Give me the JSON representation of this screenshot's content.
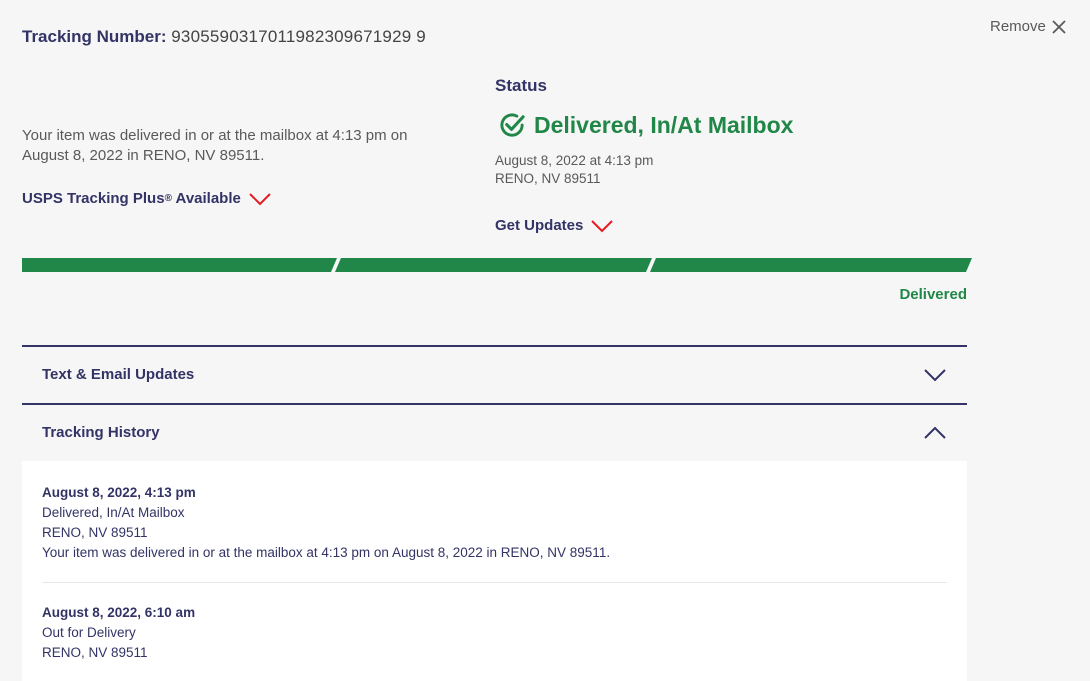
{
  "header": {
    "tracking_label": "Tracking Number:",
    "tracking_number": "9305590317011982309671929 9",
    "remove_label": "Remove"
  },
  "summary": {
    "text": "Your item was delivered in or at the mailbox at 4:13 pm on August 8, 2022 in RENO, NV 89511.",
    "tracking_plus_label": "USPS Tracking Plus",
    "tracking_plus_sup": "®",
    "tracking_plus_suffix": " Available"
  },
  "status": {
    "heading": "Status",
    "title": "Delivered, In/At Mailbox",
    "date": "August 8, 2022 at 4:13 pm",
    "location": "RENO, NV 89511",
    "get_updates_label": "Get Updates",
    "color": "#218748"
  },
  "progress": {
    "segments_complete": 3,
    "segments_total": 3,
    "label": "Delivered",
    "color": "#218748"
  },
  "sections": {
    "text_email": "Text & Email Updates",
    "history": "Tracking History"
  },
  "history": [
    {
      "when": "August 8, 2022, 4:13 pm",
      "status": "Delivered, In/At Mailbox",
      "location": "RENO, NV 89511",
      "note": "Your item was delivered in or at the mailbox at 4:13 pm on August 8, 2022 in RENO, NV 89511."
    },
    {
      "when": "August 8, 2022, 6:10 am",
      "status": "Out for Delivery",
      "location": "RENO, NV 89511",
      "note": ""
    }
  ],
  "icons": {
    "remove": "close-icon",
    "status": "check-circle-icon",
    "dropdown": "chevron-down-icon",
    "collapse": "chevron-up-icon"
  },
  "colors": {
    "brand_navy": "#333366",
    "accent_red": "#e71921",
    "success_green": "#218748"
  }
}
